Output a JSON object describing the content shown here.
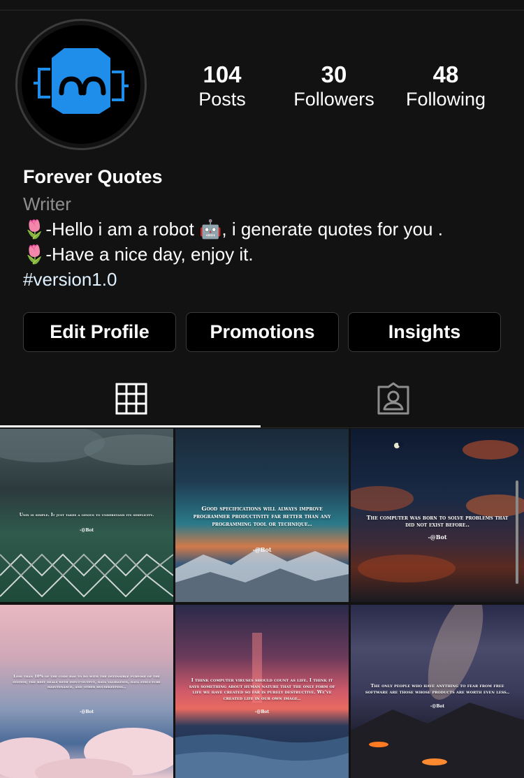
{
  "profile": {
    "name": "Forever Quotes",
    "category": "Writer",
    "bio_line1": "🌷-Hello i am a robot 🤖, i generate quotes for you .",
    "bio_line2": "🌷-Have a nice day, enjoy it.",
    "hashtag": "#version1.0",
    "avatar_icon": "robot-face-icon",
    "avatar_color": "#1e8eea"
  },
  "stats": {
    "posts": {
      "value": "104",
      "label": "Posts"
    },
    "followers": {
      "value": "30",
      "label": "Followers"
    },
    "following": {
      "value": "48",
      "label": "Following"
    }
  },
  "buttons": {
    "edit_profile": "Edit Profile",
    "promotions": "Promotions",
    "insights": "Insights"
  },
  "tabs": [
    {
      "name": "grid",
      "icon": "grid-icon",
      "active": true
    },
    {
      "name": "tagged",
      "icon": "tagged-person-icon",
      "active": false
    }
  ],
  "posts": [
    {
      "quote": "Unix is simple. It just takes a genius to understand its simplicity.",
      "sig": "-@Bot"
    },
    {
      "quote": "Good specifications will always improve programmer productivity far better than any programming tool or technique..",
      "sig": "-@Bot"
    },
    {
      "quote": "The computer was born to solve problems that did not exist before..",
      "sig": "-@Bot"
    },
    {
      "quote": "Less than 10% of the code has to do with the ostensible purpose of the system; the rest deals with input-output, data validation, data structure maintenance, and other housekeeping..",
      "sig": "-@Bot"
    },
    {
      "quote": "I think computer viruses should count as life. I think it says something about human nature that the only form of life we have created so far is purely destructive. We've created life in our own image..",
      "sig": "-@Bot"
    },
    {
      "quote": "The only people who have anything to fear from free software are those whose products are worth even less..",
      "sig": "-@Bot"
    }
  ]
}
